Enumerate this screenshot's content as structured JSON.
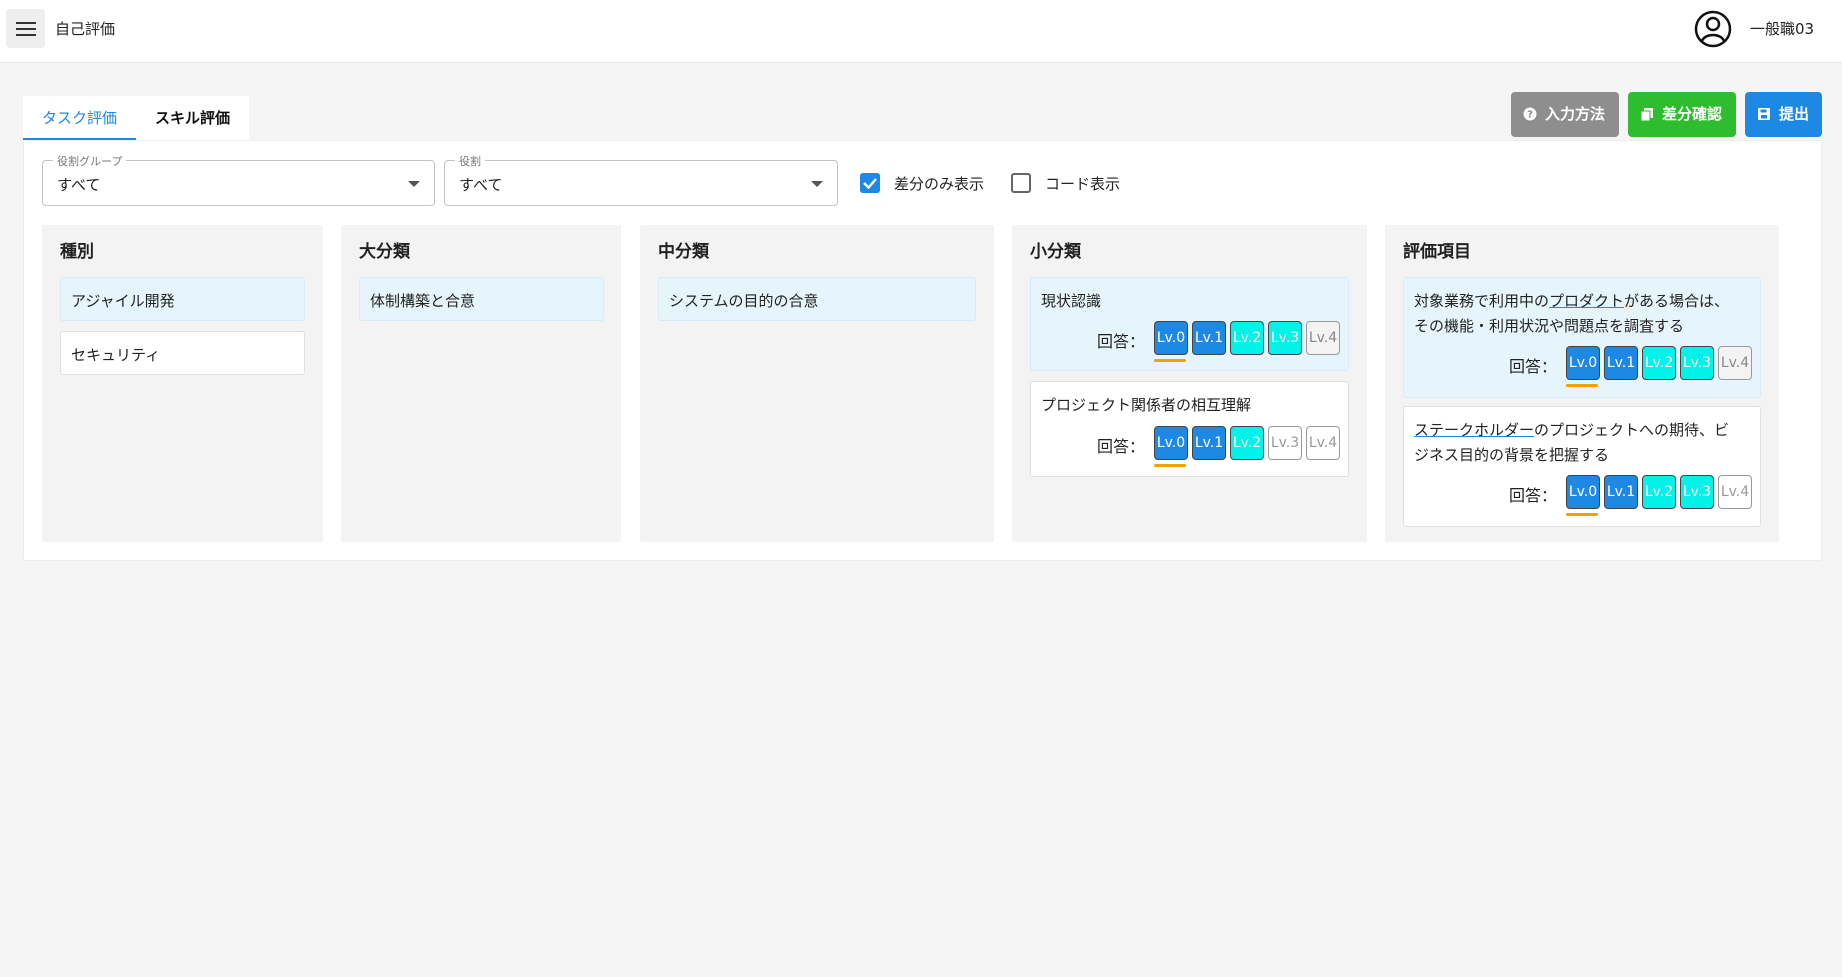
{
  "appbar": {
    "title": "自己評価",
    "user_name": "一般職03"
  },
  "tabs": {
    "task": "タスク評価",
    "skill": "スキル評価"
  },
  "actions": {
    "help": "入力方法",
    "diff": "差分確認",
    "submit": "提出"
  },
  "filters": {
    "group": {
      "label": "役割グループ",
      "value": "すべて"
    },
    "role": {
      "label": "役割",
      "value": "すべて"
    },
    "diff_only": {
      "label": "差分のみ表示",
      "checked": true
    },
    "show_code": {
      "label": "コード表示",
      "checked": false
    }
  },
  "columns": {
    "type": {
      "title": "種別",
      "items": [
        "アジャイル開発",
        "セキュリティ"
      ]
    },
    "major": {
      "title": "大分類",
      "items": [
        "体制構築と合意"
      ]
    },
    "middle": {
      "title": "中分類",
      "items": [
        "システムの目的の合意"
      ]
    },
    "minor": {
      "title": "小分類",
      "items": [
        "現状認識",
        "プロジェクト関係者の相互理解"
      ]
    },
    "eval": {
      "title": "評価項目",
      "items": [
        {
          "pre": "対象業務で利用中の",
          "link": "プロダクト",
          "post": "がある場合は、",
          "line2": "その機能・利用状況や問題点を調査する"
        },
        {
          "pre": "",
          "link": "ステークホルダー",
          "post": "のプロジェクトへの期待、ビ",
          "line2": "ジネス目的の背景を把握する"
        }
      ]
    }
  },
  "answer_label": "回答：",
  "levels": [
    "Lv.0",
    "Lv.1",
    "Lv.2",
    "Lv.3",
    "Lv.4"
  ],
  "colors": {
    "primary": "#1e88e5",
    "success": "#2ebd2e",
    "neutral": "#8e8e8e",
    "cyan": "#00f2e8",
    "marker": "#f5a000"
  }
}
